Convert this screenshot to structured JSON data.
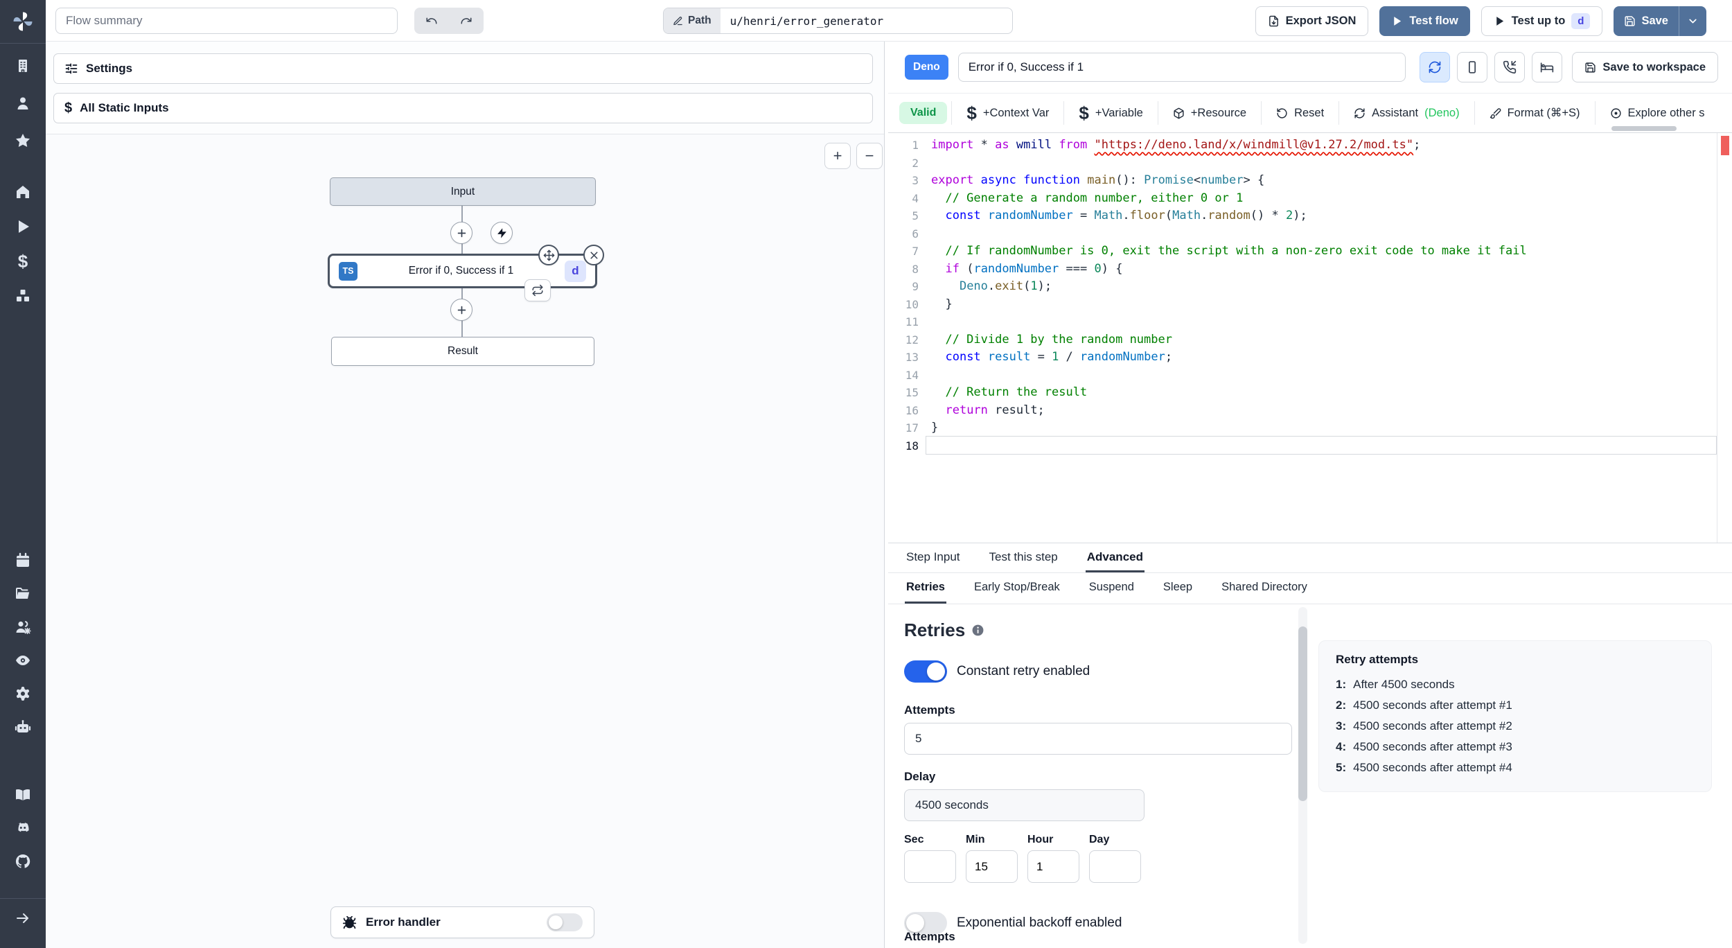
{
  "topbar": {
    "flow_summary_placeholder": "Flow summary",
    "path_label": "Path",
    "path_value": "u/henri/error_generator",
    "export_json_label": "Export JSON",
    "test_flow_label": "Test flow",
    "test_up_to_label": "Test up to",
    "test_up_to_badge": "d",
    "save_label": "Save"
  },
  "sidebar": {
    "groups": [
      [
        "building",
        "user",
        "star"
      ],
      [
        "home",
        "play",
        "dollar",
        "boxes"
      ],
      [
        "calendar",
        "folder-open",
        "users-gear",
        "eye",
        "gear",
        "bot"
      ],
      [
        "book-open",
        "discord",
        "github"
      ],
      [
        "arrow-right"
      ]
    ]
  },
  "flow": {
    "settings_label": "Settings",
    "static_inputs_label": "All Static Inputs",
    "zoom_in": "+",
    "zoom_out": "−",
    "input_node": "Input",
    "step_node": {
      "lang_badge": "TS",
      "label": "Error if 0, Success if 1",
      "id_badge": "d"
    },
    "result_node": "Result",
    "error_handler_label": "Error handler"
  },
  "editor": {
    "lang_badge": "Deno",
    "step_name": "Error if 0, Success if 1",
    "save_to_workspace_label": "Save to workspace",
    "valid_badge": "Valid",
    "header_icons": [
      {
        "icon": "refresh-cw",
        "active": true
      },
      {
        "icon": "smartphone",
        "active": false
      },
      {
        "icon": "phone-incoming",
        "active": false
      },
      {
        "icon": "bed",
        "active": false
      }
    ],
    "toolbar": [
      {
        "icon": "dollar",
        "label": "+Context Var"
      },
      {
        "icon": "dollar",
        "label": "+Variable"
      },
      {
        "icon": "package",
        "label": "+Resource"
      },
      {
        "icon": "rotate-ccw",
        "label": "Reset"
      },
      {
        "icon": "refresh-cw",
        "label": "Assistant",
        "suffix": "(Deno)"
      },
      {
        "icon": "brush",
        "label": "Format (⌘+S)"
      },
      {
        "icon": "circle-dot",
        "label": "Explore other s"
      }
    ],
    "code": {
      "lines": [
        {
          "n": 1,
          "t": [
            [
              "import",
              "kw"
            ],
            [
              " ",
              "pl"
            ],
            [
              "*",
              "pl"
            ],
            [
              " ",
              "pl"
            ],
            [
              "as",
              "kw"
            ],
            [
              " wmill ",
              "v1"
            ],
            [
              "from",
              "kw"
            ],
            [
              " ",
              "pl"
            ],
            [
              "\"https://deno.land/x/windmill@v1.27.2/mod.ts\"",
              "str sq"
            ],
            [
              ";",
              "pl"
            ]
          ]
        },
        {
          "n": 2,
          "t": []
        },
        {
          "n": 3,
          "t": [
            [
              "export",
              "kw"
            ],
            [
              " ",
              "pl"
            ],
            [
              "async",
              "st"
            ],
            [
              " ",
              "pl"
            ],
            [
              "function",
              "st"
            ],
            [
              " ",
              "pl"
            ],
            [
              "main",
              "fn"
            ],
            [
              "(): ",
              "pl"
            ],
            [
              "Promise",
              "ty"
            ],
            [
              "<",
              "pl"
            ],
            [
              "number",
              "ty"
            ],
            [
              "> {",
              "pl"
            ]
          ]
        },
        {
          "n": 4,
          "t": [
            [
              "  // Generate a random number, either 0 or 1",
              "cm"
            ]
          ]
        },
        {
          "n": 5,
          "t": [
            [
              "  ",
              "pl"
            ],
            [
              "const",
              "st"
            ],
            [
              " ",
              "pl"
            ],
            [
              "randomNumber",
              "v2"
            ],
            [
              " = ",
              "pl"
            ],
            [
              "Math",
              "ty"
            ],
            [
              ".",
              "pl"
            ],
            [
              "floor",
              "fn"
            ],
            [
              "(",
              "pl"
            ],
            [
              "Math",
              "ty"
            ],
            [
              ".",
              "pl"
            ],
            [
              "random",
              "fn"
            ],
            [
              "() ",
              "pl"
            ],
            [
              "*",
              "pl"
            ],
            [
              " ",
              "pl"
            ],
            [
              "2",
              "num"
            ],
            [
              ");",
              "pl"
            ]
          ]
        },
        {
          "n": 6,
          "t": []
        },
        {
          "n": 7,
          "t": [
            [
              "  // If randomNumber is 0, exit the script with a non-zero exit code to make it fail",
              "cm"
            ]
          ]
        },
        {
          "n": 8,
          "t": [
            [
              "  ",
              "pl"
            ],
            [
              "if",
              "kw"
            ],
            [
              " (",
              "pl"
            ],
            [
              "randomNumber",
              "v2"
            ],
            [
              " === ",
              "pl"
            ],
            [
              "0",
              "num"
            ],
            [
              ") {",
              "pl"
            ]
          ]
        },
        {
          "n": 9,
          "t": [
            [
              "    ",
              "pl"
            ],
            [
              "Deno",
              "ty"
            ],
            [
              ".",
              "pl"
            ],
            [
              "exit",
              "fn"
            ],
            [
              "(",
              "pl"
            ],
            [
              "1",
              "num"
            ],
            [
              ");",
              "pl"
            ]
          ]
        },
        {
          "n": 10,
          "t": [
            [
              "  }",
              "pl"
            ]
          ]
        },
        {
          "n": 11,
          "t": []
        },
        {
          "n": 12,
          "t": [
            [
              "  // Divide 1 by the random number",
              "cm"
            ]
          ]
        },
        {
          "n": 13,
          "t": [
            [
              "  ",
              "pl"
            ],
            [
              "const",
              "st"
            ],
            [
              " ",
              "pl"
            ],
            [
              "result",
              "v2"
            ],
            [
              " = ",
              "pl"
            ],
            [
              "1",
              "num"
            ],
            [
              " / ",
              "pl"
            ],
            [
              "randomNumber",
              "v2"
            ],
            [
              ";",
              "pl"
            ]
          ]
        },
        {
          "n": 14,
          "t": []
        },
        {
          "n": 15,
          "t": [
            [
              "  // Return the result",
              "cm"
            ]
          ]
        },
        {
          "n": 16,
          "t": [
            [
              "  ",
              "pl"
            ],
            [
              "return",
              "kw"
            ],
            [
              " result;",
              "pl"
            ]
          ]
        },
        {
          "n": 17,
          "t": [
            [
              "}",
              "pl"
            ]
          ]
        },
        {
          "n": 18,
          "t": []
        }
      ],
      "current_line": 18
    }
  },
  "panel": {
    "tabs": [
      {
        "label": "Step Input",
        "active": false
      },
      {
        "label": "Test this step",
        "active": false
      },
      {
        "label": "Advanced",
        "active": true
      }
    ],
    "subtabs": [
      {
        "label": "Retries",
        "active": true
      },
      {
        "label": "Early Stop/Break",
        "active": false
      },
      {
        "label": "Suspend",
        "active": false
      },
      {
        "label": "Sleep",
        "active": false
      },
      {
        "label": "Shared Directory",
        "active": false
      }
    ],
    "retries": {
      "heading": "Retries",
      "constant_label": "Constant retry enabled",
      "constant_enabled": true,
      "attempts_label": "Attempts",
      "attempts_value": "5",
      "delay_label": "Delay",
      "delay_value": "4500 seconds",
      "units": [
        {
          "label": "Sec",
          "value": ""
        },
        {
          "label": "Min",
          "value": "15"
        },
        {
          "label": "Hour",
          "value": "1"
        },
        {
          "label": "Day",
          "value": ""
        }
      ],
      "exponential_label": "Exponential backoff enabled",
      "exponential_enabled": false,
      "cutoff_label": "Attempts"
    },
    "retry_preview": {
      "title": "Retry attempts",
      "items": [
        {
          "n": "1:",
          "text": "After 4500 seconds"
        },
        {
          "n": "2:",
          "text": "4500 seconds after attempt #1"
        },
        {
          "n": "3:",
          "text": "4500 seconds after attempt #2"
        },
        {
          "n": "4:",
          "text": "4500 seconds after attempt #3"
        },
        {
          "n": "5:",
          "text": "4500 seconds after attempt #4"
        }
      ]
    }
  },
  "colors": {
    "accent_blue": "#51719a",
    "toggle_on": "#2563eb",
    "deno_badge": "#3c82f6",
    "valid_green": "#0d9448",
    "ts_badge": "#3178c6",
    "id_badge_bg": "#dfe6fe",
    "id_badge_text": "#4744e0",
    "error_marker": "#ef5f5c",
    "sidebar_bg": "#333a47"
  }
}
